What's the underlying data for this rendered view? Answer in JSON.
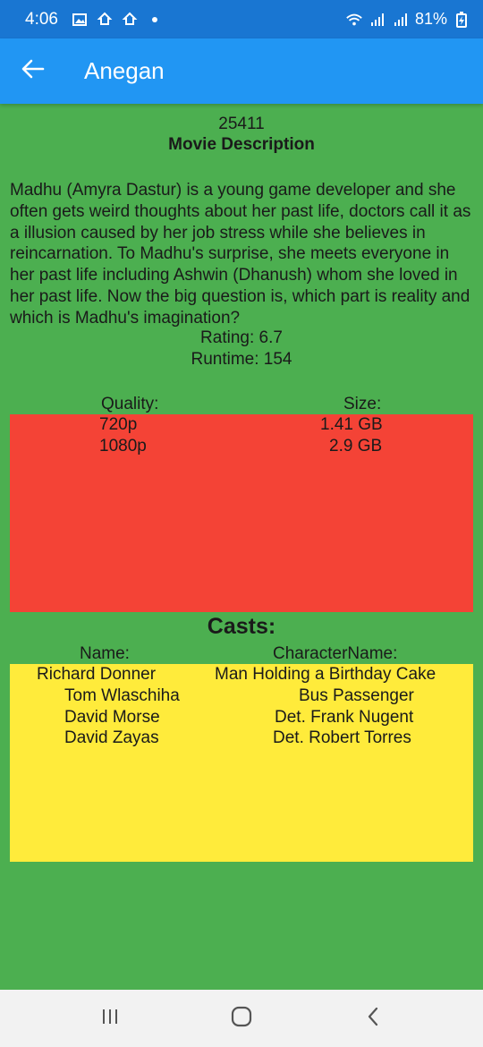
{
  "status_bar": {
    "time": "4:06",
    "battery": "81%",
    "icons": [
      "image-icon",
      "sync-icon",
      "sync-icon",
      "dot-icon",
      "wifi-icon",
      "signal-icon",
      "signal-icon",
      "battery-charging-icon"
    ]
  },
  "app_bar": {
    "title": "Anegan",
    "back_icon": "arrow-left-icon"
  },
  "movie": {
    "id": "25411",
    "description_heading": "Movie Description",
    "description": "Madhu (Amyra Dastur) is a young game developer and she often gets weird thoughts about her past life, doctors call it as a illusion caused by her job stress while she believes in reincarnation. To Madhu's surprise, she meets everyone in her past life including Ashwin (Dhanush) whom she loved in her past life. Now the big question is, which part is reality and which is Madhu's imagination?",
    "rating": "Rating: 6.7",
    "runtime": "Runtime: 154"
  },
  "torrents": {
    "quality_label": "Quality:",
    "size_label": "Size:",
    "rows": [
      {
        "quality": "720p",
        "size": "1.41 GB"
      },
      {
        "quality": "1080p",
        "size": "2.9 GB"
      }
    ]
  },
  "casts": {
    "heading": "Casts:",
    "name_label": "Name:",
    "character_label": "CharacterName:",
    "rows": [
      {
        "name": "Richard Donner",
        "character": "Man Holding a Birthday Cake"
      },
      {
        "name": "Tom Wlaschiha",
        "character": "Bus Passenger"
      },
      {
        "name": "David Morse",
        "character": "Det. Frank Nugent"
      },
      {
        "name": "David Zayas",
        "character": "Det. Robert Torres"
      }
    ]
  },
  "colors": {
    "status_bar": "#1976d2",
    "app_bar": "#2196f3",
    "background": "#4caf50",
    "quality_box": "#f44336",
    "cast_box": "#ffeb3b",
    "nav_bar": "#f2f2f2"
  },
  "nav_bar": {
    "icons": [
      "recent-apps-icon",
      "home-icon",
      "back-icon"
    ]
  }
}
